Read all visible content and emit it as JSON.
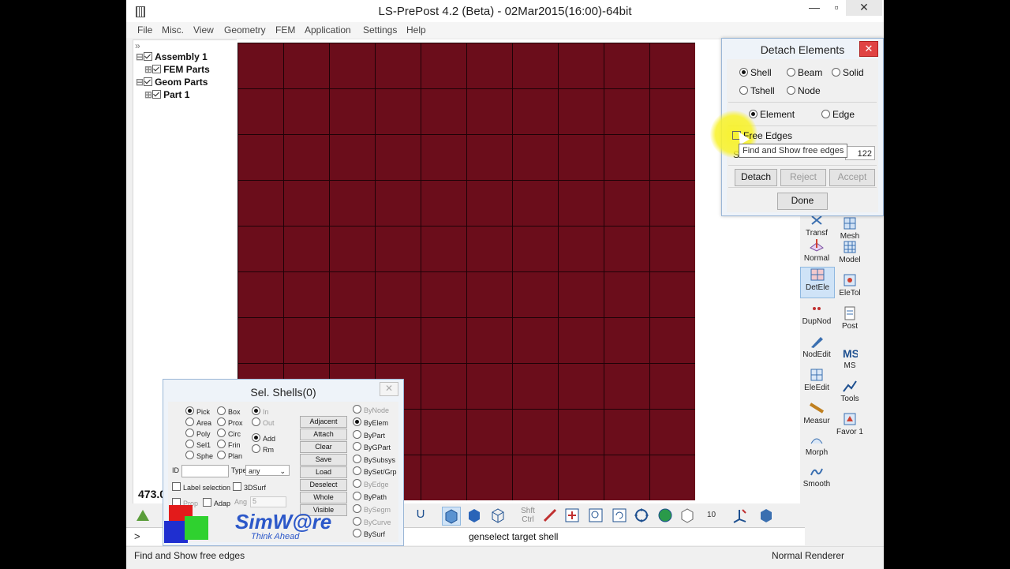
{
  "window": {
    "title": "LS-PrePost 4.2 (Beta) - 02Mar2015(16:00)-64bit"
  },
  "menu": [
    "File",
    "Misc.",
    "View",
    "Geometry",
    "FEM",
    "Application",
    "Settings",
    "Help"
  ],
  "tree": {
    "expander": "»",
    "items": [
      {
        "label": "Assembly 1"
      },
      {
        "label": "FEM Parts"
      },
      {
        "label": "Geom Parts"
      },
      {
        "label": "Part 1"
      }
    ]
  },
  "viewport": {
    "model_number": "473.0",
    "mesh_color": "#6b0d1b"
  },
  "detach_dialog": {
    "title": "Detach Elements",
    "close": "✕",
    "types": [
      {
        "label": "Shell",
        "selected": true
      },
      {
        "label": "Beam",
        "selected": false
      },
      {
        "label": "Solid",
        "selected": false
      },
      {
        "label": "Tshell",
        "selected": false
      },
      {
        "label": "Node",
        "selected": false
      }
    ],
    "modes": [
      {
        "label": "Element",
        "selected": true
      },
      {
        "label": "Edge",
        "selected": false
      }
    ],
    "free_edges": {
      "label": "Free Edges",
      "checked": false
    },
    "tooltip": "Find and Show free edges",
    "partial_label": "S",
    "count_value": "122",
    "buttons": {
      "detach": "Detach",
      "reject": "Reject",
      "accept": "Accept",
      "done": "Done"
    }
  },
  "right_tools": [
    {
      "label": "Transf",
      "icon": "transform-icon"
    },
    {
      "label": "Mesh",
      "icon": "mesh-icon"
    },
    {
      "label": "Normal",
      "icon": "normal-icon"
    },
    {
      "label": "Model",
      "icon": "model-icon"
    },
    {
      "label": "DetEle",
      "icon": "detach-element-icon",
      "active": true
    },
    {
      "label": "EleTol",
      "icon": "element-tolerance-icon"
    },
    {
      "label": "DupNod",
      "icon": "duplicate-node-icon"
    },
    {
      "label": "Post",
      "icon": "post-icon"
    },
    {
      "label": "NodEdit",
      "icon": "node-edit-icon"
    },
    {
      "label": "MS",
      "icon": "ms-icon"
    },
    {
      "label": "EleEdit",
      "icon": "element-edit-icon"
    },
    {
      "label": "Tools",
      "icon": "tools-icon"
    },
    {
      "label": "Measur",
      "icon": "measure-icon"
    },
    {
      "label": "Favor 1",
      "icon": "favorite-icon"
    },
    {
      "label": "Morph",
      "icon": "morph-icon"
    },
    {
      "label": "Smooth",
      "icon": "smooth-icon"
    }
  ],
  "select_dialog": {
    "title": "Sel. Shells(0)",
    "close": "✕",
    "methods": [
      {
        "label": "Pick",
        "selected": true
      },
      {
        "label": "Box",
        "selected": false
      },
      {
        "label": "Area",
        "selected": false
      },
      {
        "label": "Prox",
        "selected": false
      },
      {
        "label": "Poly",
        "selected": false
      },
      {
        "label": "Circ",
        "selected": false
      },
      {
        "label": "Sel1",
        "selected": false
      },
      {
        "label": "Frin",
        "selected": false
      },
      {
        "label": "Sphe",
        "selected": false
      },
      {
        "label": "Plan",
        "selected": false
      }
    ],
    "inout": [
      {
        "label": "In",
        "selected": true,
        "disabled": true
      },
      {
        "label": "Out",
        "selected": false,
        "disabled": true
      }
    ],
    "addrm": [
      {
        "label": "Add",
        "selected": true
      },
      {
        "label": "Rm",
        "selected": false
      }
    ],
    "buttons": [
      "Adjacent",
      "Attach",
      "Clear",
      "Save",
      "Load",
      "Deselect",
      "Whole",
      "Visible"
    ],
    "by": [
      {
        "label": "ByNode",
        "selected": false,
        "disabled": true
      },
      {
        "label": "ByElem",
        "selected": true,
        "disabled": false
      },
      {
        "label": "ByPart",
        "selected": false,
        "disabled": false
      },
      {
        "label": "ByGPart",
        "selected": false,
        "disabled": false
      },
      {
        "label": "BySubsys",
        "selected": false,
        "disabled": false
      },
      {
        "label": "BySet/Grp",
        "selected": false,
        "disabled": false
      },
      {
        "label": "ByEdge",
        "selected": false,
        "disabled": true
      },
      {
        "label": "ByPath",
        "selected": false,
        "disabled": false
      },
      {
        "label": "BySegm",
        "selected": false,
        "disabled": true
      },
      {
        "label": "ByCurve",
        "selected": false,
        "disabled": true
      },
      {
        "label": "BySurf",
        "selected": false,
        "disabled": false
      }
    ],
    "id_label": "ID",
    "type_label": "Type",
    "type_value": "any",
    "label_selection": "Label selection",
    "surf3d": "3DSurf",
    "prop": "Prop",
    "adap": "Adap",
    "ang_label": "Ang",
    "ang_value": "5"
  },
  "logo": {
    "name": "SimW@re",
    "tagline": "Think Ahead"
  },
  "toolbar": {
    "shift_ctrl": "Shft\nCtrl",
    "zoom_num": "10",
    "u_label": "U"
  },
  "command": {
    "prompt": ">",
    "text": "genselect target shell"
  },
  "status": {
    "left": "Find and Show free edges",
    "right": "Normal Renderer"
  }
}
